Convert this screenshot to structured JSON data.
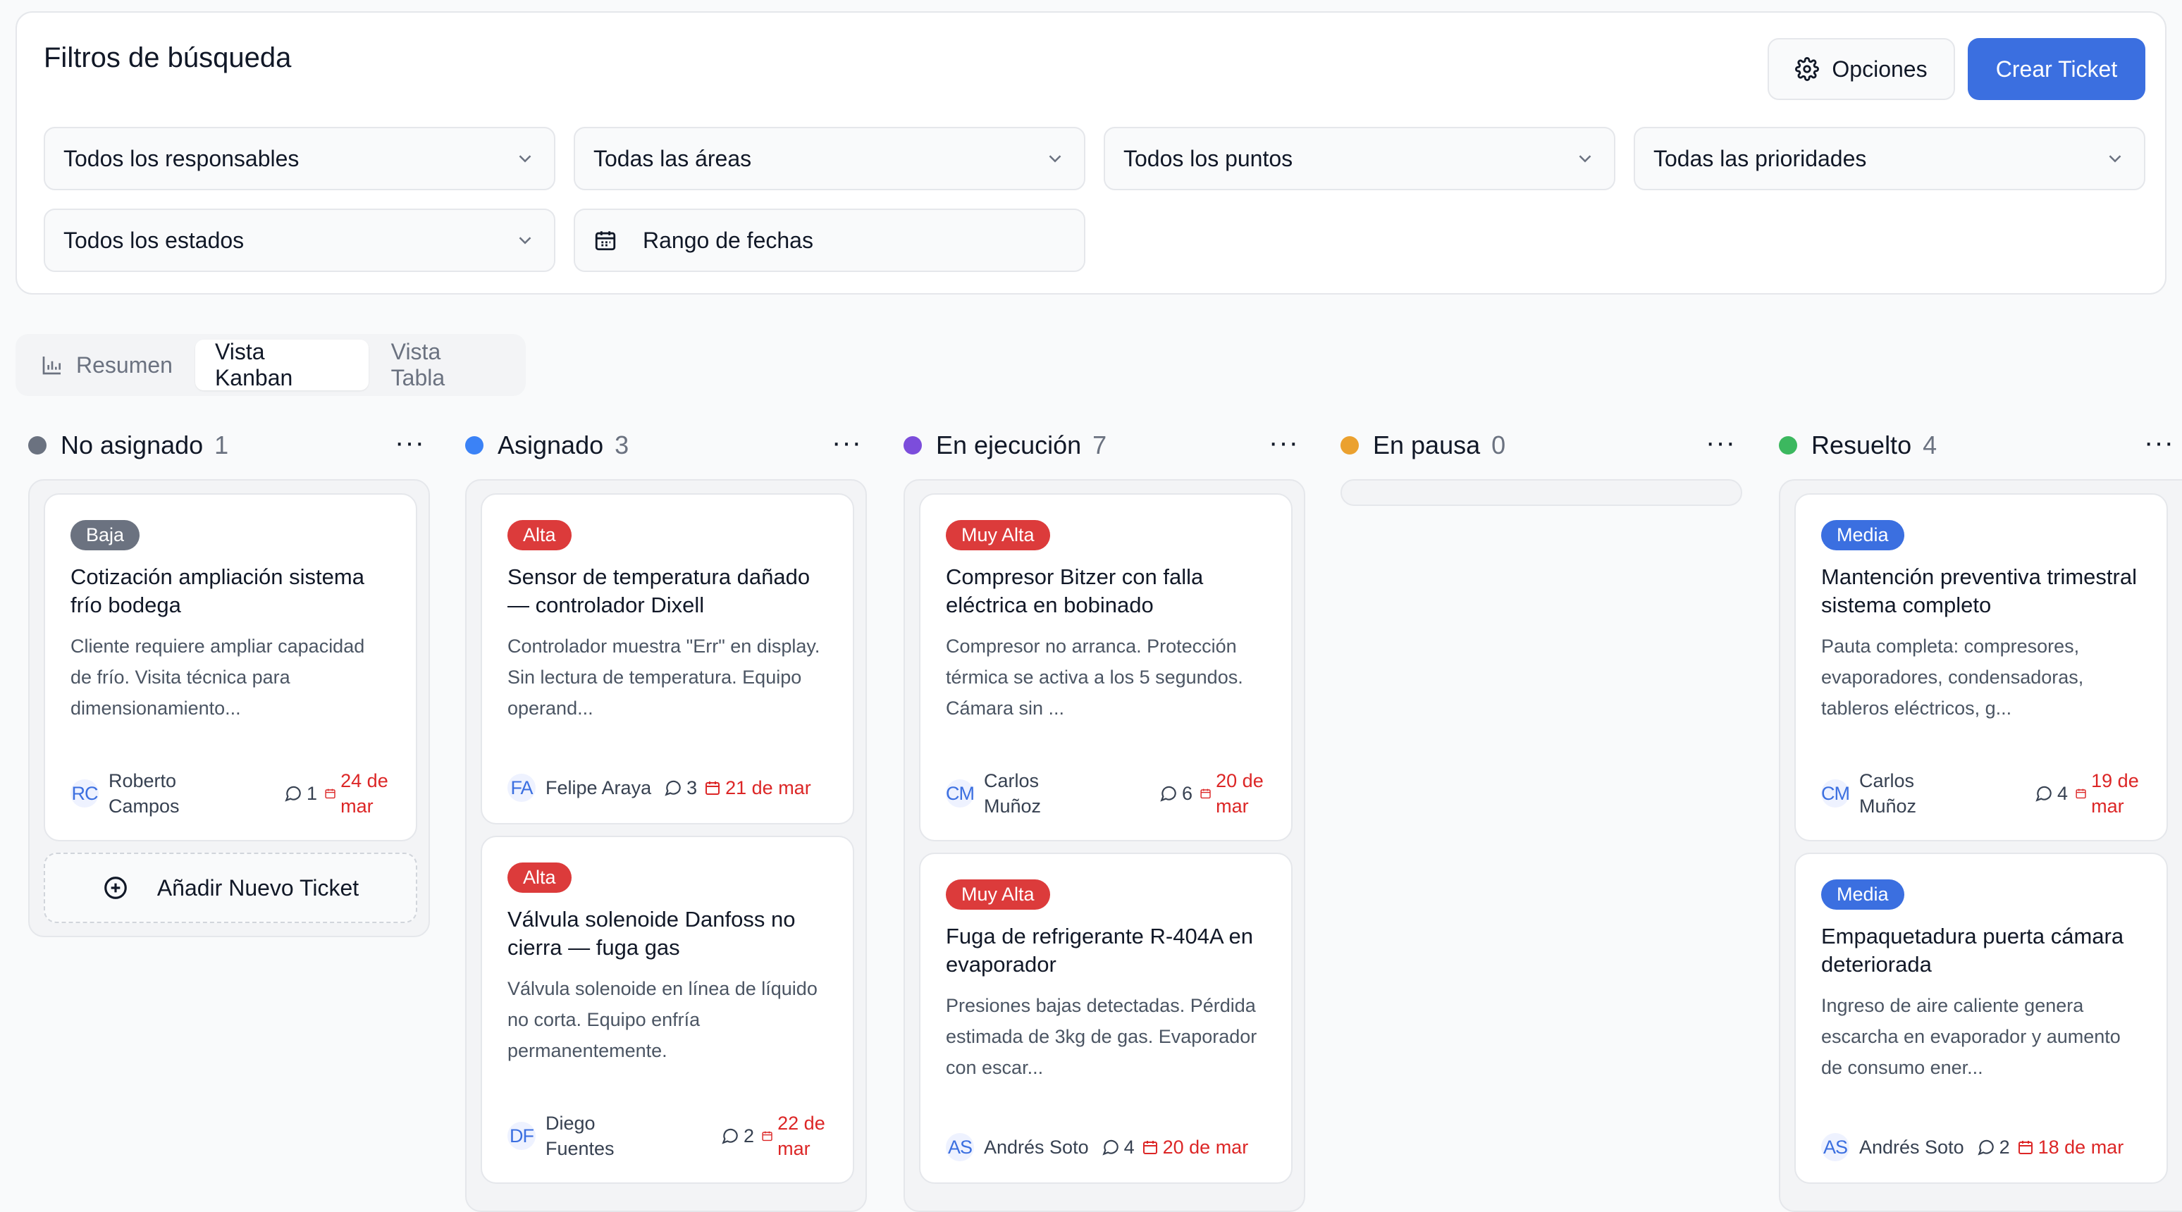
{
  "filters": {
    "title": "Filtros de búsqueda",
    "options_label": "Opciones",
    "create_label": "Crear Ticket",
    "selects": [
      {
        "label": "Todos los responsables"
      },
      {
        "label": "Todas las áreas"
      },
      {
        "label": "Todos los puntos"
      },
      {
        "label": "Todas las prioridades"
      },
      {
        "label": "Todos los estados"
      }
    ],
    "date_range": "Rango de fechas"
  },
  "tabs": [
    {
      "label": "Resumen"
    },
    {
      "label": "Vista Kanban",
      "active": true
    },
    {
      "label": "Vista Tabla"
    }
  ],
  "columns": [
    {
      "title": "No asignado",
      "count": "1",
      "color": "#6b7280"
    },
    {
      "title": "Asignado",
      "count": "3",
      "color": "#3b82f6"
    },
    {
      "title": "En ejecución",
      "count": "7",
      "color": "#7c4ddb"
    },
    {
      "title": "En pausa",
      "count": "0",
      "color": "#eba12f"
    },
    {
      "title": "Resuelto",
      "count": "4",
      "color": "#3cb85f"
    }
  ],
  "cards": [
    {
      "priority": "Baja",
      "priority_color": "#6b7280",
      "title": "Cotización ampliación sistema frío bodega",
      "desc": "Cliente requiere ampliar capacidad de frío. Visita técnica para dimensionamiento...",
      "initials": "RC",
      "person": "Roberto Campos",
      "comments": "1",
      "date": "24 de mar"
    },
    {
      "priority": "Alta",
      "priority_color": "#dc3b3b",
      "title": "Sensor de temperatura dañado — controlador Dixell",
      "desc": "Controlador muestra \"Err\" en display. Sin lectura de temperatura. Equipo operand...",
      "initials": "FA",
      "person": "Felipe Araya",
      "comments": "3",
      "date": "21 de mar"
    },
    {
      "priority": "Alta",
      "priority_color": "#dc3b3b",
      "title": "Válvula solenoide Danfoss no cierra — fuga gas",
      "desc": "Válvula solenoide en línea de líquido no corta. Equipo enfría permanentemente.",
      "initials": "DF",
      "person": "Diego Fuentes",
      "comments": "2",
      "date": "22 de mar"
    },
    {
      "priority": "Muy Alta",
      "priority_color": "#dc3b3b",
      "title": "Compresor Bitzer con falla eléctrica en bobinado",
      "desc": "Compresor no arranca. Protección térmica se activa a los 5 segundos. Cámara sin ...",
      "initials": "CM",
      "person": "Carlos Muñoz",
      "comments": "6",
      "date": "20 de mar"
    },
    {
      "priority": "Muy Alta",
      "priority_color": "#dc3b3b",
      "title": "Fuga de refrigerante R-404A en evaporador",
      "desc": "Presiones bajas detectadas. Pérdida estimada de 3kg de gas. Evaporador con escar...",
      "initials": "AS",
      "person": "Andrés Soto",
      "comments": "4",
      "date": "20 de mar"
    },
    {
      "priority": "Media",
      "priority_color": "#3b6fe0",
      "title": "Mantención preventiva trimestral sistema completo",
      "desc": "Pauta completa: compresores, evaporadores, condensadoras, tableros eléctricos, g...",
      "initials": "CM",
      "person": "Carlos Muñoz",
      "comments": "4",
      "date": "19 de mar"
    },
    {
      "priority": "Media",
      "priority_color": "#3b6fe0",
      "title": "Empaquetadura puerta cámara deteriorada",
      "desc": "Ingreso de aire caliente genera escarcha en evaporador y aumento de consumo ener...",
      "initials": "AS",
      "person": "Andrés Soto",
      "comments": "2",
      "date": "18 de mar"
    }
  ],
  "add_ticket_label": "Añadir Nuevo Ticket"
}
